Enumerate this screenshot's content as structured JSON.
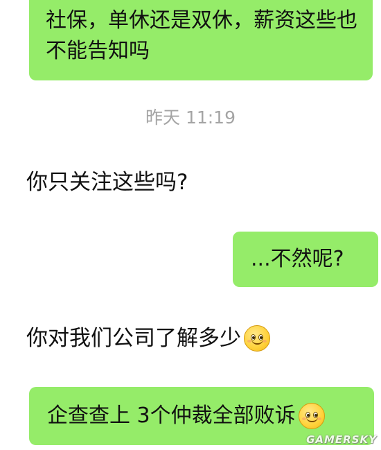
{
  "messages": [
    {
      "side": "right",
      "text": "社保，单休还是双休，薪资这些也不能告知吗"
    },
    {
      "timestamp": "昨天 11:19"
    },
    {
      "side": "left",
      "text": "你只关注这些吗?"
    },
    {
      "side": "right",
      "text": "...不然呢?"
    },
    {
      "side": "left",
      "text": "你对我们公司了解多少",
      "emoji": "smile-emoji-icon"
    },
    {
      "side": "right",
      "text": "企查查上 3个仲裁全部败诉",
      "emoji": "smile-emoji-icon"
    }
  ],
  "colors": {
    "bubble_right": "#95ec69",
    "background": "#ffffff",
    "timestamp": "#a4a4a4"
  },
  "watermark": "GAMERSKY"
}
